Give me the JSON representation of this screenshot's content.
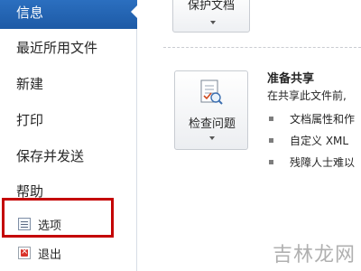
{
  "nav": {
    "items": [
      {
        "label": "信息"
      },
      {
        "label": "最近所用文件"
      },
      {
        "label": "新建"
      },
      {
        "label": "打印"
      },
      {
        "label": "保存并发送"
      },
      {
        "label": "帮助"
      },
      {
        "label": "选项"
      },
      {
        "label": "退出"
      }
    ],
    "accent_color": "#2a6ebd",
    "highlight_color": "#c40000"
  },
  "content": {
    "top_button_label": "保护文档",
    "check_button_label": "检查问题",
    "section_title": "准备共享",
    "section_description": "在共享此文件前,",
    "bullets": [
      "文档属性和作",
      "自定义 XML",
      "残障人士难以"
    ]
  },
  "watermark": "吉林龙网"
}
